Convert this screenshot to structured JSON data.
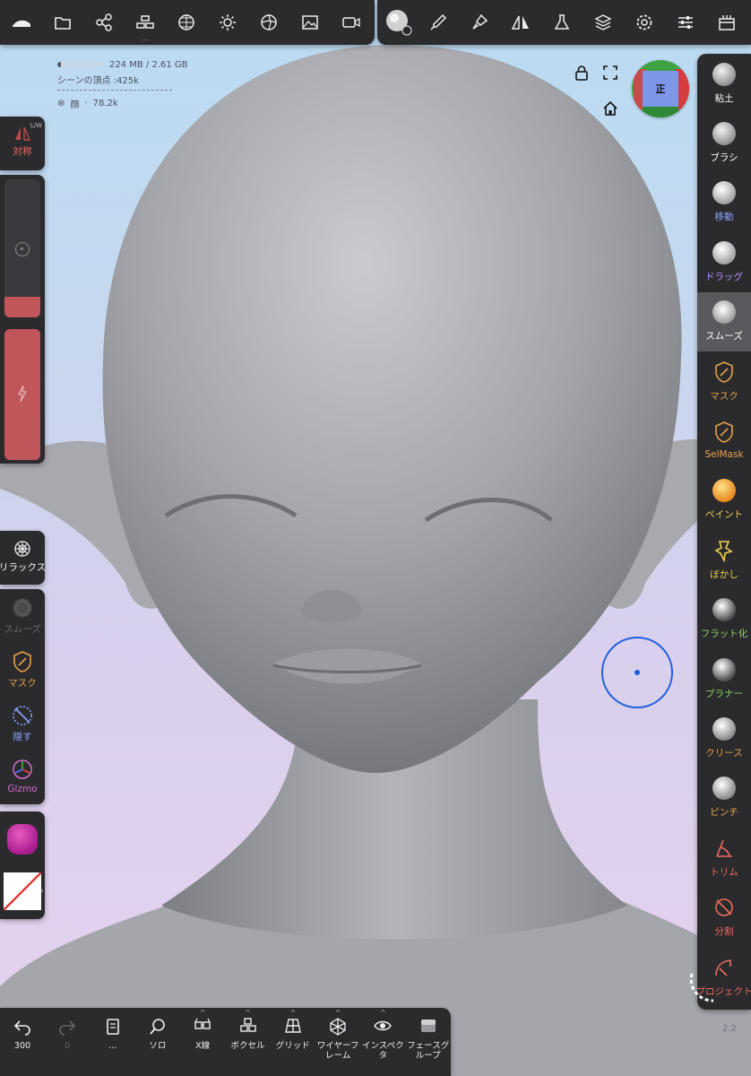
{
  "colors": {
    "panel": "#2b2b2e",
    "active_tool": "#5a5a5e",
    "symmetry_red": "#b84a4a",
    "brush_cursor": "#1e5fe0",
    "label_white": "#ffffff",
    "label_blue": "#8fa3ff",
    "label_purple": "#b391ff",
    "label_orange": "#e7a24b",
    "label_yellow": "#f0cf52",
    "label_green": "#8bd160",
    "label_red": "#ef6a5c"
  },
  "top_toolbar": {
    "left_icons": [
      "logo-icon",
      "folder-icon",
      "scene-graph-icon",
      "stack-icon",
      "sphere-mesh-icon",
      "light-sun-icon",
      "shading-icon",
      "background-icon",
      "camera-icon"
    ],
    "right_icons": [
      "active-tool-thumb-icon",
      "brush-icon",
      "paint-brush-icon",
      "symmetry-icon",
      "flask-icon",
      "layers-icon",
      "settings-icon",
      "sliders-icon",
      "interface-icon"
    ],
    "more_dots": "..."
  },
  "info": {
    "memory": "224 MB / 2.61 GB",
    "memory_fraction": 0.086,
    "scene_vertices": "シーンの頂点 :425k",
    "mesh_name": "顔",
    "mesh_count": "78.2k"
  },
  "view_cube": {
    "label": "正"
  },
  "right_tools": [
    {
      "label": "粘土",
      "color": "#ffffff"
    },
    {
      "label": "ブラシ",
      "color": "#ffffff"
    },
    {
      "label": "移動",
      "color": "#8fa3ff"
    },
    {
      "label": "ドラッグ",
      "color": "#b391ff"
    },
    {
      "label": "スムーズ",
      "color": "#ffffff"
    },
    {
      "label": "マスク",
      "color": "#e7a24b"
    },
    {
      "label": "SelMask",
      "color": "#e7a24b"
    },
    {
      "label": "ペイント",
      "color": "#f0cf52"
    },
    {
      "label": "ぼかし",
      "color": "#f0cf52"
    },
    {
      "label": "フラット化",
      "color": "#8bd160"
    },
    {
      "label": "プラナー",
      "color": "#8bd160"
    },
    {
      "label": "クリース",
      "color": "#e7a24b"
    },
    {
      "label": "ピンチ",
      "color": "#e7a24b"
    },
    {
      "label": "トリム",
      "color": "#ef6a5c"
    },
    {
      "label": "分割",
      "color": "#ef6a5c"
    },
    {
      "label": "プロジェクト",
      "color": "#ef6a5c"
    }
  ],
  "left": {
    "symmetry_label": "対称",
    "symmetry_badge": "L/W",
    "relax_label": "リラックス",
    "tools": [
      {
        "label": "スムーズ",
        "color": "#666666"
      },
      {
        "label": "マスク",
        "color": "#e7a24b"
      },
      {
        "label": "隠す",
        "color": "#8fa3ff"
      },
      {
        "label": "Gizmo",
        "color": "#d26bd0"
      }
    ],
    "radius_fraction": 0.1,
    "intensity_fraction": 1.0
  },
  "bottom_toolbar": [
    {
      "label": "300",
      "caret": false,
      "dim": false
    },
    {
      "label": "0",
      "caret": false,
      "dim": true
    },
    {
      "label": "...",
      "caret": false,
      "dim": false
    },
    {
      "label": "ソロ",
      "caret": false,
      "dim": false
    },
    {
      "label": "X線",
      "caret": true,
      "dim": false
    },
    {
      "label": "ボクセル",
      "caret": true,
      "dim": false
    },
    {
      "label": "グリッド",
      "caret": true,
      "dim": false
    },
    {
      "label": "ワイヤーフレーム",
      "caret": true,
      "dim": false
    },
    {
      "label": "インスペクタ",
      "caret": true,
      "dim": false
    },
    {
      "label": "フェースグループ",
      "caret": false,
      "dim": false
    }
  ],
  "version": "2.2"
}
